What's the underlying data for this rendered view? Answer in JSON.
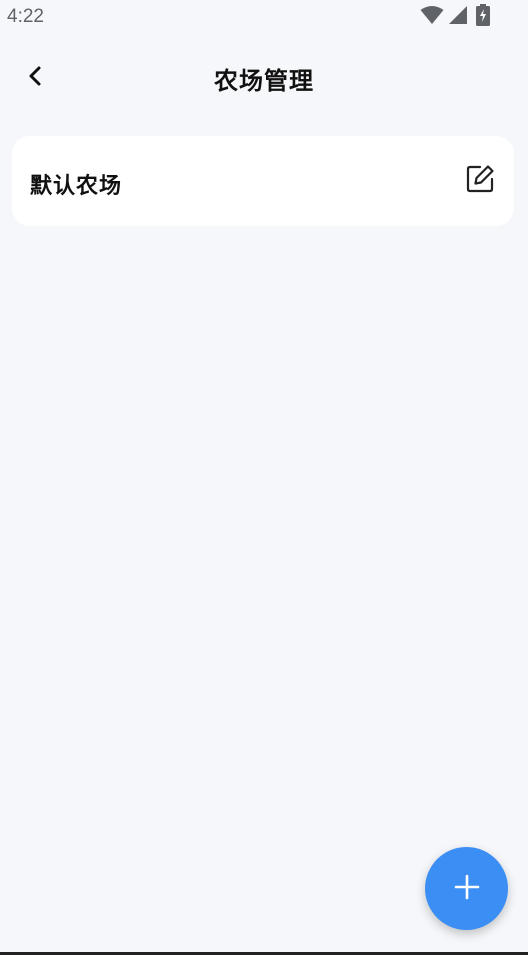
{
  "status_bar": {
    "time": "4:22",
    "icons": [
      "wifi-icon",
      "cellular-signal-icon",
      "battery-charging-icon"
    ]
  },
  "app_bar": {
    "title": "农场管理",
    "back_icon": "chevron-left-icon"
  },
  "farms": [
    {
      "name": "默认农场",
      "action_icon": "edit-icon"
    }
  ],
  "fab": {
    "icon": "plus-icon",
    "color": "#3b8ef3"
  },
  "colors": {
    "background": "#f5f7fa",
    "card": "#ffffff",
    "accent": "#3b8ef3",
    "text": "#111111",
    "status_text": "#5f6368"
  }
}
